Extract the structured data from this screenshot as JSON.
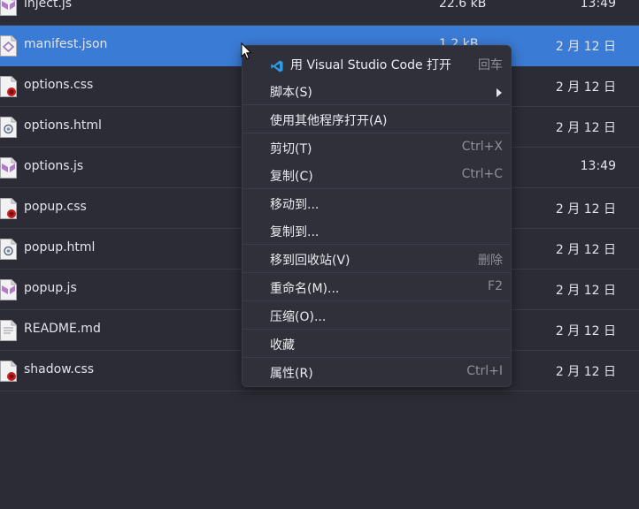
{
  "files": [
    {
      "name": "inject.js",
      "size": "22.6 kB",
      "date": "13:49",
      "icon": "javascript-file-icon",
      "selected": false
    },
    {
      "name": "manifest.json",
      "size": "1.2 kB",
      "date": "2 月 12 日",
      "icon": "json-file-icon",
      "selected": true
    },
    {
      "name": "options.css",
      "size": "",
      "date": "2 月 12 日",
      "icon": "css-file-icon",
      "selected": false
    },
    {
      "name": "options.html",
      "size": "",
      "date": "2 月 12 日",
      "icon": "html-file-icon",
      "selected": false
    },
    {
      "name": "options.js",
      "size": "",
      "date": "13:49",
      "icon": "javascript-file-icon",
      "selected": false
    },
    {
      "name": "popup.css",
      "size": "",
      "date": "2 月 12 日",
      "icon": "css-file-icon",
      "selected": false
    },
    {
      "name": "popup.html",
      "size": "",
      "date": "2 月 12 日",
      "icon": "html-file-icon",
      "selected": false
    },
    {
      "name": "popup.js",
      "size": "",
      "date": "2 月 12 日",
      "icon": "javascript-file-icon",
      "selected": false
    },
    {
      "name": "README.md",
      "size": "",
      "date": "2 月 12 日",
      "icon": "text-file-icon",
      "selected": false
    },
    {
      "name": "shadow.css",
      "size": "",
      "date": "2 月 12 日",
      "icon": "css-file-icon",
      "selected": false
    }
  ],
  "context_menu": {
    "items": [
      {
        "label": "用 Visual Studio Code 打开",
        "shortcut": "回车",
        "icon": "vscode-icon"
      },
      {
        "label": "脚本(S)",
        "shortcut": "",
        "submenu": true
      },
      {
        "label": "使用其他程序打开(A)",
        "shortcut": ""
      },
      {
        "label": "剪切(T)",
        "shortcut": "Ctrl+X"
      },
      {
        "label": "复制(C)",
        "shortcut": "Ctrl+C"
      },
      {
        "label": "移动到...",
        "shortcut": ""
      },
      {
        "label": "复制到...",
        "shortcut": ""
      },
      {
        "label": "移到回收站(V)",
        "shortcut": "删除"
      },
      {
        "label": "重命名(M)...",
        "shortcut": "F2"
      },
      {
        "label": "压缩(O)...",
        "shortcut": ""
      },
      {
        "label": "收藏",
        "shortcut": ""
      },
      {
        "label": "属性(R)",
        "shortcut": "Ctrl+I"
      }
    ]
  },
  "colors": {
    "background": "#2b2c35",
    "selection": "#3a7bd5",
    "menu_background": "#2f3039"
  }
}
